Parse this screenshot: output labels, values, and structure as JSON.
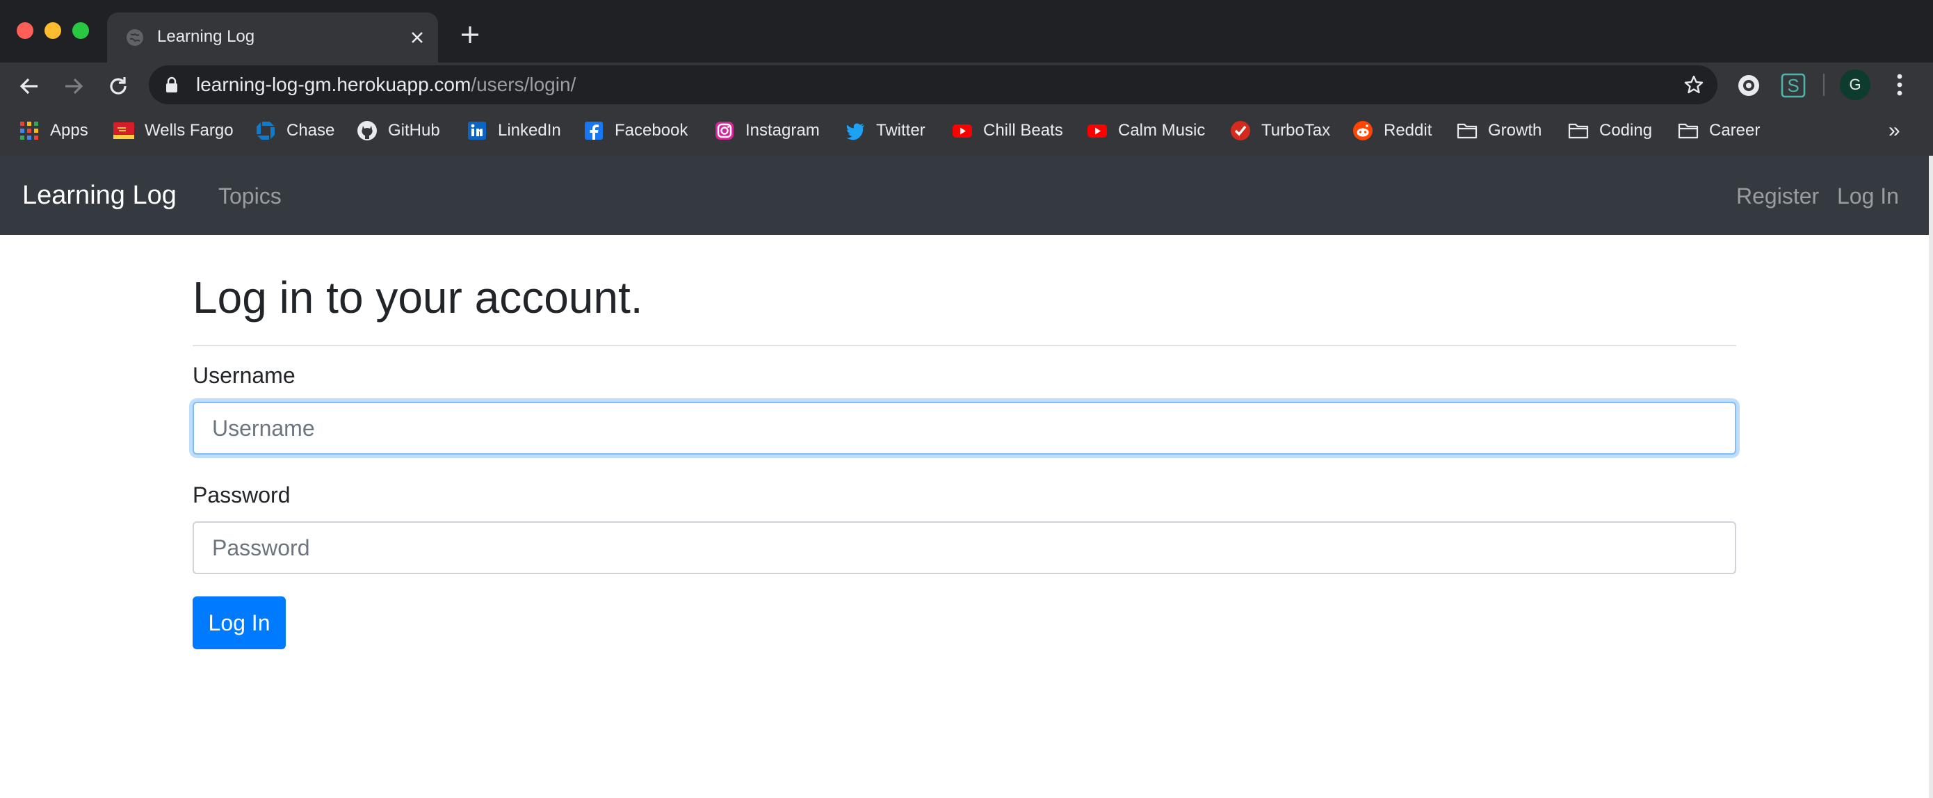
{
  "browser": {
    "tab": {
      "title": "Learning Log"
    },
    "address": {
      "host": "learning-log-gm.herokuapp.com",
      "path": "/users/login/"
    },
    "profile_initial": "G",
    "bookmarks": [
      {
        "label": "Apps",
        "icon": "apps-grid-icon"
      },
      {
        "label": "Wells Fargo",
        "icon": "wells-fargo-icon"
      },
      {
        "label": "Chase",
        "icon": "chase-icon"
      },
      {
        "label": "GitHub",
        "icon": "github-icon"
      },
      {
        "label": "LinkedIn",
        "icon": "linkedin-icon"
      },
      {
        "label": "Facebook",
        "icon": "facebook-icon"
      },
      {
        "label": "Instagram",
        "icon": "instagram-icon"
      },
      {
        "label": "Twitter",
        "icon": "twitter-icon"
      },
      {
        "label": "Chill Beats",
        "icon": "youtube-icon"
      },
      {
        "label": "Calm Music",
        "icon": "youtube-icon"
      },
      {
        "label": "TurboTax",
        "icon": "turbotax-icon"
      },
      {
        "label": "Reddit",
        "icon": "reddit-icon"
      },
      {
        "label": "Growth",
        "icon": "folder-icon"
      },
      {
        "label": "Coding",
        "icon": "folder-icon"
      },
      {
        "label": "Career",
        "icon": "folder-icon"
      }
    ],
    "more_label": "»"
  },
  "navbar": {
    "brand": "Learning Log",
    "topics": "Topics",
    "register": "Register",
    "login": "Log In"
  },
  "form": {
    "heading": "Log in to your account.",
    "username_label": "Username",
    "username_placeholder": "Username",
    "password_label": "Password",
    "password_placeholder": "Password",
    "submit_label": "Log In"
  },
  "colors": {
    "navbar_bg": "#343a40",
    "primary": "#007bff",
    "chrome_bg": "#202124",
    "toolbar_bg": "#35363a"
  }
}
